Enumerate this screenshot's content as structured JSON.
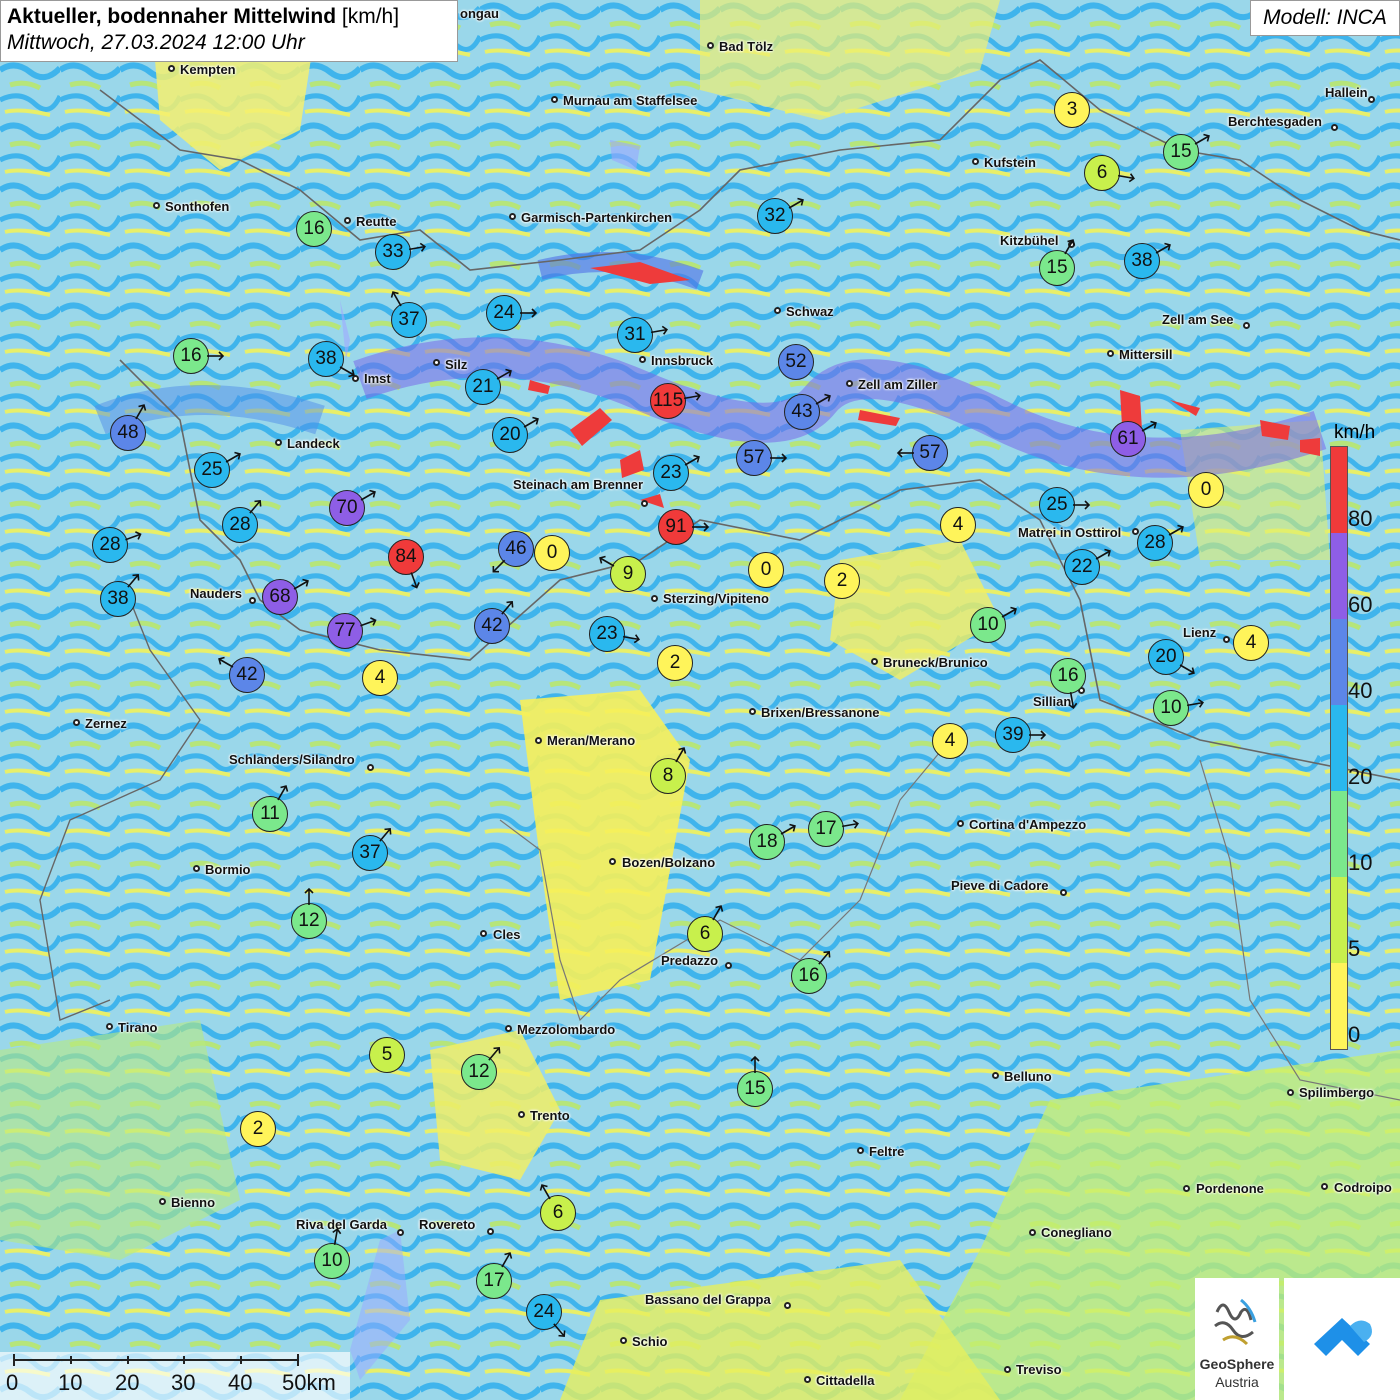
{
  "title": {
    "main": "Aktueller, bodennaher Mittelwind",
    "unit": "[km/h]",
    "datetime": "Mittwoch, 27.03.2024 12:00 Uhr"
  },
  "model": "Modell: INCA",
  "legend": {
    "unit": "km/h",
    "ticks": [
      "80",
      "60",
      "40",
      "20",
      "10",
      "5",
      "0"
    ],
    "colors": [
      "#f03a3a",
      "#8e5ee6",
      "#5c86e8",
      "#2ab8ee",
      "#7be88c",
      "#c8f04c",
      "#fff45a"
    ]
  },
  "scale": {
    "ticks": [
      "0",
      "10",
      "20",
      "30",
      "40",
      "50km"
    ]
  },
  "logos": {
    "geosphere_line1": "GeoSphere",
    "geosphere_line2": "Austria"
  },
  "cities": [
    "Kempten",
    "Bad Tölz",
    "Hallein",
    "Murnau am Staffelsee",
    "Berchtesgaden",
    "Kufstein",
    "Sonthofen",
    "Reutte",
    "Garmisch-Partenkirchen",
    "Kitzbühel",
    "Schwaz",
    "Zell am See",
    "Silz",
    "Innsbruck",
    "Mittersill",
    "Imst",
    "Zell am Ziller",
    "Landeck",
    "Steinach am Brenner",
    "Matrei in Osttirol",
    "Nauders",
    "Sterzing/Vipiteno",
    "Lienz",
    "Bruneck/Brunico",
    "Sillian",
    "Zernez",
    "Brixen/Bressanone",
    "Meran/Merano",
    "Schlanders/Silandro",
    "Cortina d'Ampezzo",
    "Bozen/Bolzano",
    "Bormio",
    "Pieve di Cadore",
    "Cles",
    "Predazzo",
    "Tirano",
    "Mezzolombardo",
    "Belluno",
    "Spilimbergo",
    "Trento",
    "Feltre",
    "Pordenone",
    "Codroipo",
    "Bienno",
    "Riva del Garda",
    "Rovereto",
    "Conegliano",
    "Bassano del Grappa",
    "Schio",
    "Treviso",
    "Cittadella",
    "ongau"
  ],
  "stations": [
    {
      "v": "3",
      "dir": null
    },
    {
      "v": "15",
      "dir": 60
    },
    {
      "v": "6",
      "dir": 100
    },
    {
      "v": "32",
      "dir": 60
    },
    {
      "v": "16",
      "dir": null
    },
    {
      "v": "33",
      "dir": 80
    },
    {
      "v": "15",
      "dir": 30
    },
    {
      "v": "38",
      "dir": 60
    },
    {
      "v": "37",
      "dir": 330
    },
    {
      "v": "24",
      "dir": 90
    },
    {
      "v": "31",
      "dir": 80
    },
    {
      "v": "16",
      "dir": 90
    },
    {
      "v": "38",
      "dir": 120
    },
    {
      "v": "21",
      "dir": 60
    },
    {
      "v": "52",
      "dir": null
    },
    {
      "v": "115",
      "dir": 80
    },
    {
      "v": "43",
      "dir": 60
    },
    {
      "v": "48",
      "dir": 30
    },
    {
      "v": "20",
      "dir": 60
    },
    {
      "v": "61",
      "dir": 60
    },
    {
      "v": "25",
      "dir": 60
    },
    {
      "v": "23",
      "dir": 60
    },
    {
      "v": "57",
      "dir": 90
    },
    {
      "v": "57",
      "dir": 270
    },
    {
      "v": "0",
      "dir": null
    },
    {
      "v": "70",
      "dir": 60
    },
    {
      "v": "28",
      "dir": 40
    },
    {
      "v": "25",
      "dir": 90
    },
    {
      "v": "91",
      "dir": 90
    },
    {
      "v": "4",
      "dir": null
    },
    {
      "v": "28",
      "dir": 70
    },
    {
      "v": "84",
      "dir": 160
    },
    {
      "v": "46",
      "dir": 225
    },
    {
      "v": "0",
      "dir": null
    },
    {
      "v": "28",
      "dir": 60
    },
    {
      "v": "9",
      "dir": 300
    },
    {
      "v": "0",
      "dir": null
    },
    {
      "v": "2",
      "dir": null
    },
    {
      "v": "22",
      "dir": 60
    },
    {
      "v": "38",
      "dir": 40
    },
    {
      "v": "68",
      "dir": 60
    },
    {
      "v": "77",
      "dir": 70
    },
    {
      "v": "10",
      "dir": 60
    },
    {
      "v": "42",
      "dir": 40
    },
    {
      "v": "23",
      "dir": 100
    },
    {
      "v": "4",
      "dir": null
    },
    {
      "v": "42",
      "dir": 300
    },
    {
      "v": "2",
      "dir": null
    },
    {
      "v": "16",
      "dir": 170
    },
    {
      "v": "20",
      "dir": 120
    },
    {
      "v": "4",
      "dir": null
    },
    {
      "v": "10",
      "dir": 80
    },
    {
      "v": "4",
      "dir": null
    },
    {
      "v": "39",
      "dir": 90
    },
    {
      "v": "8",
      "dir": 30
    },
    {
      "v": "11",
      "dir": 30
    },
    {
      "v": "18",
      "dir": 60
    },
    {
      "v": "17",
      "dir": 80
    },
    {
      "v": "37",
      "dir": 40
    },
    {
      "v": "12",
      "dir": 0
    },
    {
      "v": "6",
      "dir": 30
    },
    {
      "v": "16",
      "dir": 40
    },
    {
      "v": "5",
      "dir": null
    },
    {
      "v": "12",
      "dir": 40
    },
    {
      "v": "15",
      "dir": 0
    },
    {
      "v": "2",
      "dir": null
    },
    {
      "v": "6",
      "dir": 330
    },
    {
      "v": "10",
      "dir": 10
    },
    {
      "v": "17",
      "dir": 30
    },
    {
      "v": "24",
      "dir": 140
    }
  ]
}
